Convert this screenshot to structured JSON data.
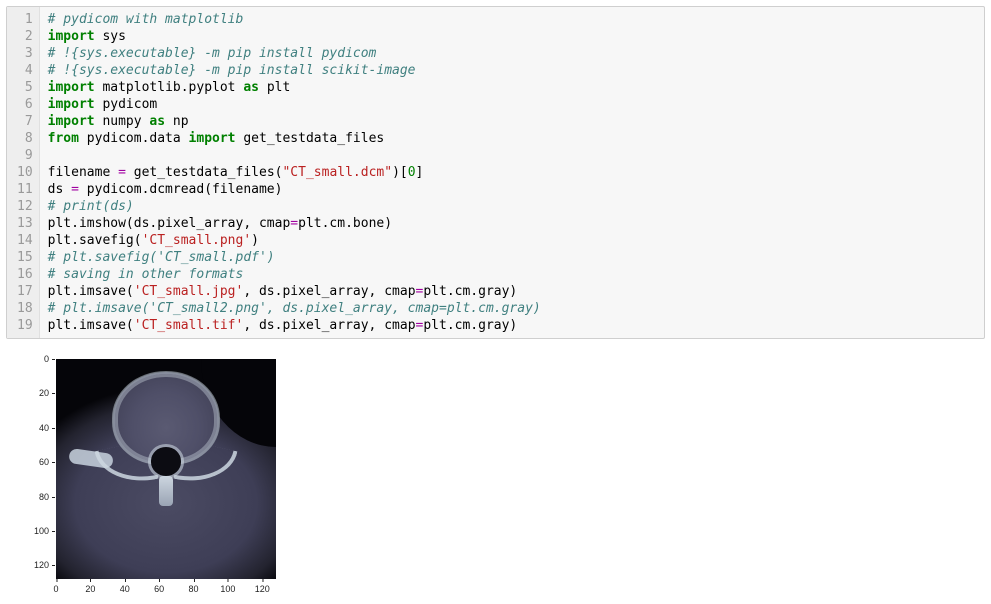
{
  "editor": {
    "line_numbers": [
      "1",
      "2",
      "3",
      "4",
      "5",
      "6",
      "7",
      "8",
      "9",
      "10",
      "11",
      "12",
      "13",
      "14",
      "15",
      "16",
      "17",
      "18",
      "19"
    ],
    "lines": [
      [
        {
          "cls": "c",
          "t": "# pydicom with matplotlib"
        }
      ],
      [
        {
          "cls": "kn",
          "t": "import"
        },
        {
          "cls": "n",
          "t": " sys"
        }
      ],
      [
        {
          "cls": "c",
          "t": "# !{sys.executable} -m pip install pydicom"
        }
      ],
      [
        {
          "cls": "c",
          "t": "# !{sys.executable} -m pip install scikit-image"
        }
      ],
      [
        {
          "cls": "kn",
          "t": "import"
        },
        {
          "cls": "n",
          "t": " matplotlib.pyplot "
        },
        {
          "cls": "kn",
          "t": "as"
        },
        {
          "cls": "n",
          "t": " plt"
        }
      ],
      [
        {
          "cls": "kn",
          "t": "import"
        },
        {
          "cls": "n",
          "t": " pydicom"
        }
      ],
      [
        {
          "cls": "kn",
          "t": "import"
        },
        {
          "cls": "n",
          "t": " numpy "
        },
        {
          "cls": "kn",
          "t": "as"
        },
        {
          "cls": "n",
          "t": " np"
        }
      ],
      [
        {
          "cls": "kn",
          "t": "from"
        },
        {
          "cls": "n",
          "t": " pydicom.data "
        },
        {
          "cls": "kn",
          "t": "import"
        },
        {
          "cls": "n",
          "t": " get_testdata_files"
        }
      ],
      [],
      [
        {
          "cls": "n",
          "t": "filename "
        },
        {
          "cls": "op",
          "t": "="
        },
        {
          "cls": "n",
          "t": " get_testdata_files("
        },
        {
          "cls": "s",
          "t": "\"CT_small.dcm\""
        },
        {
          "cls": "n",
          "t": ")["
        },
        {
          "cls": "m",
          "t": "0"
        },
        {
          "cls": "n",
          "t": "]"
        }
      ],
      [
        {
          "cls": "n",
          "t": "ds "
        },
        {
          "cls": "op",
          "t": "="
        },
        {
          "cls": "n",
          "t": " pydicom.dcmread(filename)"
        }
      ],
      [
        {
          "cls": "c",
          "t": "# print(ds)"
        }
      ],
      [
        {
          "cls": "n",
          "t": "plt.imshow(ds.pixel_array, cmap"
        },
        {
          "cls": "op",
          "t": "="
        },
        {
          "cls": "n",
          "t": "plt.cm.bone)"
        }
      ],
      [
        {
          "cls": "n",
          "t": "plt.savefig("
        },
        {
          "cls": "s",
          "t": "'CT_small.png'"
        },
        {
          "cls": "n",
          "t": ")"
        }
      ],
      [
        {
          "cls": "c",
          "t": "# plt.savefig('CT_small.pdf')"
        }
      ],
      [
        {
          "cls": "c",
          "t": "# saving in other formats"
        }
      ],
      [
        {
          "cls": "n",
          "t": "plt.imsave("
        },
        {
          "cls": "s",
          "t": "'CT_small.jpg'"
        },
        {
          "cls": "n",
          "t": ", ds.pixel_array, cmap"
        },
        {
          "cls": "op",
          "t": "="
        },
        {
          "cls": "n",
          "t": "plt.cm.gray)"
        }
      ],
      [
        {
          "cls": "c",
          "t": "# plt.imsave('CT_small2.png', ds.pixel_array, cmap=plt.cm.gray)"
        }
      ],
      [
        {
          "cls": "n",
          "t": "plt.imsave("
        },
        {
          "cls": "s",
          "t": "'CT_small.tif'"
        },
        {
          "cls": "n",
          "t": ", ds.pixel_array, cmap"
        },
        {
          "cls": "op",
          "t": "="
        },
        {
          "cls": "n",
          "t": "plt.cm.gray)"
        }
      ]
    ]
  },
  "chart_data": {
    "type": "heatmap",
    "title": "",
    "xlabel": "",
    "ylabel": "",
    "xticks": [
      0,
      20,
      40,
      60,
      80,
      100,
      120
    ],
    "yticks": [
      0,
      20,
      40,
      60,
      80,
      100,
      120
    ],
    "xlim": [
      0,
      128
    ],
    "ylim": [
      128,
      0
    ],
    "colormap": "bone",
    "description": "CT axial slice (CT_small.dcm sample) showing vertebral body, spinal canal, posterior arch and surrounding soft tissue rendered with matplotlib bone colormap."
  }
}
